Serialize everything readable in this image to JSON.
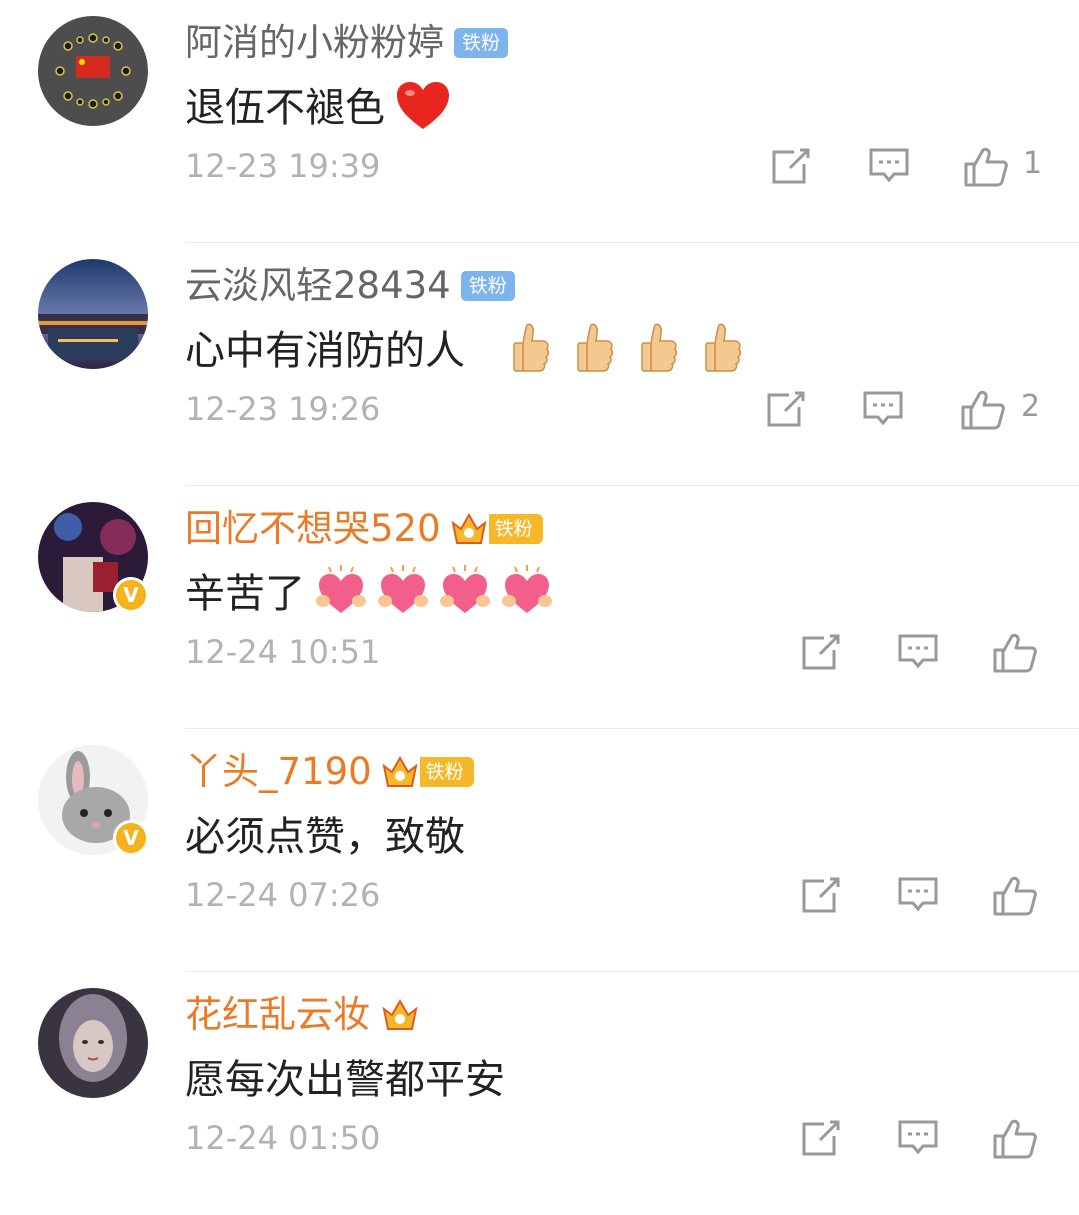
{
  "comments": [
    {
      "username": "阿消的小粉粉婷",
      "name_color": "gray",
      "badge": "铁粉",
      "badge_style": "blue",
      "text": "退伍不褪色",
      "emojis": [
        "heart-emoji"
      ],
      "time": "12-23 19:39",
      "likes": "1",
      "avatar": "flag-avatar"
    },
    {
      "username": "云淡风轻28434",
      "name_color": "gray",
      "badge": "铁粉",
      "badge_style": "blue",
      "text": "心中有消防的人",
      "emojis": [
        "thumbs-up-emoji",
        "thumbs-up-emoji",
        "thumbs-up-emoji",
        "thumbs-up-emoji"
      ],
      "time": "12-23 19:26",
      "likes": "2",
      "avatar": "city-avatar"
    },
    {
      "username": "回忆不想哭520",
      "name_color": "orange",
      "badge": "铁粉",
      "badge_style": "gold",
      "text": "辛苦了",
      "emojis": [
        "hug-heart-emoji",
        "hug-heart-emoji",
        "hug-heart-emoji",
        "hug-heart-emoji"
      ],
      "time": "12-24 10:51",
      "likes": "",
      "avatar": "night-avatar",
      "verified": "V"
    },
    {
      "username": "丫头_7190",
      "name_color": "orange",
      "badge": "铁粉",
      "badge_style": "gold",
      "text": "必须点赞，致敬",
      "emojis": [],
      "time": "12-24 07:26",
      "likes": "",
      "avatar": "rabbit-avatar",
      "verified": "V"
    },
    {
      "username": "花红乱云妆",
      "name_color": "orange",
      "badge": "",
      "badge_style": "crown-only",
      "text": "愿每次出警都平安",
      "emojis": [],
      "time": "12-24 01:50",
      "likes": "",
      "avatar": "portrait-avatar"
    }
  ],
  "colors": {
    "name_gray": "#666666",
    "name_orange": "#eb7a26",
    "badge_blue": "#7db4ec",
    "badge_gold": "#f4b829",
    "time_gray": "#b2b2b2",
    "icon_gray": "#999999"
  }
}
